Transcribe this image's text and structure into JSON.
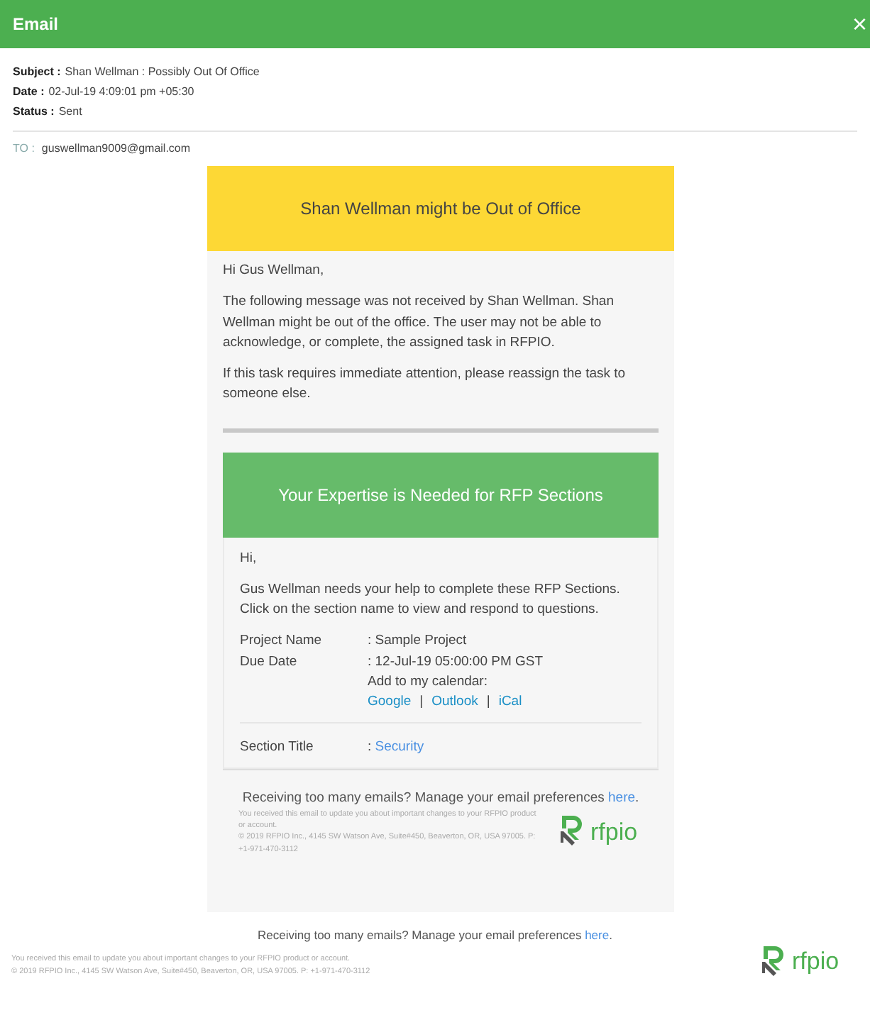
{
  "window": {
    "title": "Email",
    "close": "×"
  },
  "meta": [
    {
      "label": "Subject :",
      "value": "Shan Wellman : Possibly Out Of Office"
    },
    {
      "label": "Date :",
      "value": "02-Jul-19  4:09:01 pm +05:30"
    },
    {
      "label": "Status :",
      "value": "Sent"
    }
  ],
  "to": {
    "label": "TO :",
    "value": "guswellman9009@gmail.com"
  },
  "email": {
    "banner": "Shan Wellman might be Out of Office",
    "paragraphs": [
      "Hi Gus Wellman,",
      "The following message was not received by Shan Wellman. Shan Wellman might be out of the office. The user may not be able to acknowledge, or complete, the assigned task in RFPIO.",
      "If this task requires immediate attention, please reassign the task to someone else."
    ],
    "inner": {
      "banner": "Your Expertise is Needed for RFP Sections",
      "paragraphs": [
        "Hi,",
        "Gus Wellman needs your help to complete these RFP Sections. Click on the section name to view and respond to questions."
      ],
      "fields": [
        {
          "label": "Project Name",
          "value": ": Sample Project"
        },
        {
          "label": "Due Date",
          "value": ": 12-Jul-19 05:00:00 PM GST"
        }
      ],
      "calendar_label": "Add to my calendar:",
      "calendar_links": [
        "Google",
        "Outlook",
        "iCal"
      ],
      "separator": "|",
      "section": {
        "label": "Section Title",
        "colon": ":",
        "link": "Security"
      }
    },
    "footer": {
      "prefs": {
        "text": "Receiving too many emails? Manage your email preferences ",
        "link": "here",
        "after": "."
      },
      "notice": "You received this email to update you about important changes to your RFPIO product or account.",
      "address": "© 2019 RFPIO Inc., 4145 SW Watson Ave, Suite#450, Beaverton, OR, USA 97005. P: +1-971-470-3112",
      "logo": "rfpio"
    }
  },
  "page_footer": {
    "prefs": {
      "text": "Receiving too many emails? Manage your email preferences ",
      "link": "here",
      "after": "."
    },
    "notice": "You received this email to update you about important changes to your RFPIO product or account.",
    "address": "© 2019 RFPIO Inc., 4145 SW Watson Ave, Suite#450, Beaverton, OR, USA 97005. P: +1-971-470-3112",
    "logo": "rfpio"
  }
}
